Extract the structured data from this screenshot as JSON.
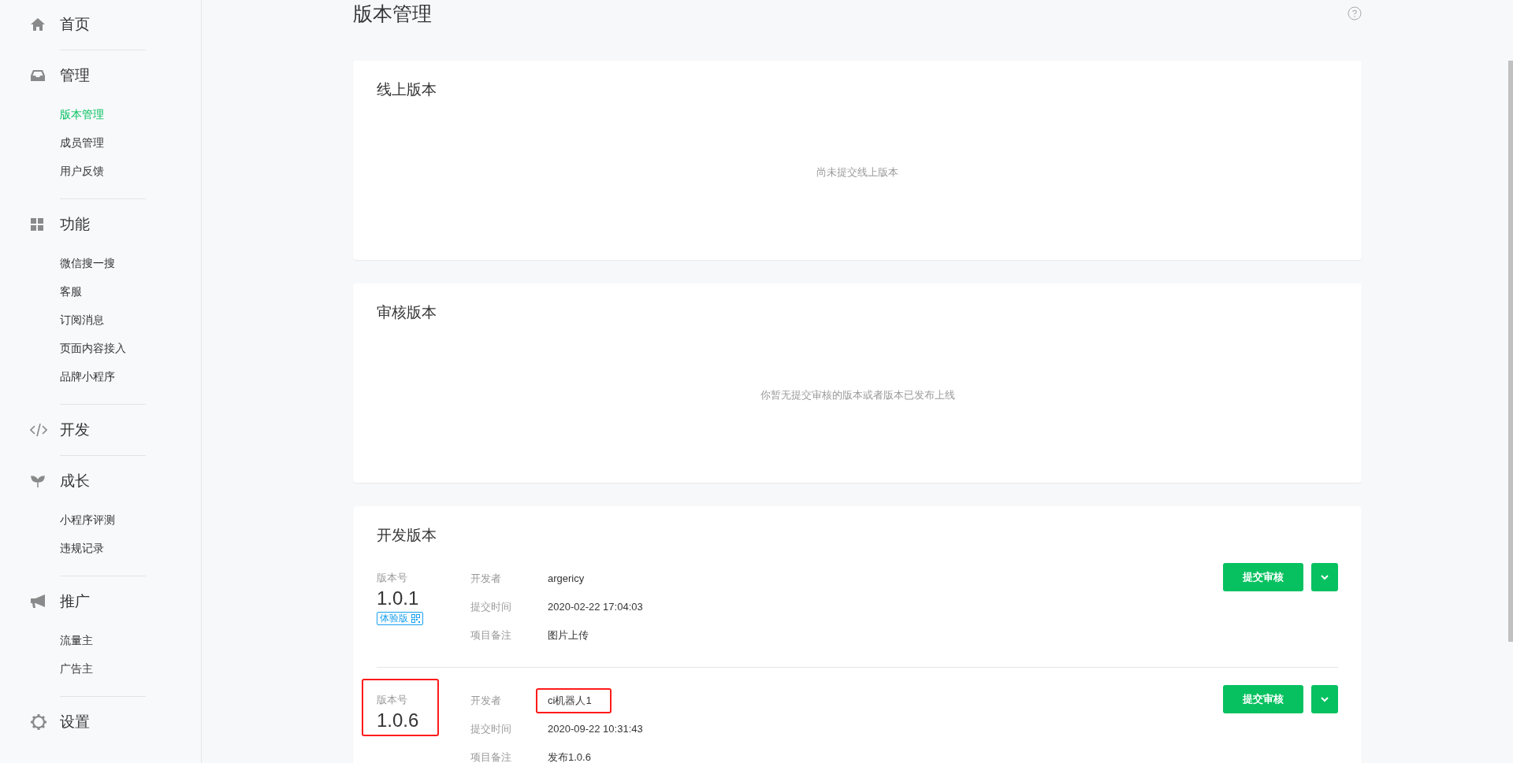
{
  "sidebar": {
    "groups": [
      {
        "label": "首页"
      },
      {
        "label": "管理",
        "items": [
          {
            "label": "版本管理",
            "selected": true
          },
          {
            "label": "成员管理",
            "selected": false
          },
          {
            "label": "用户反馈",
            "selected": false
          }
        ]
      },
      {
        "label": "功能",
        "items": [
          {
            "label": "微信搜一搜",
            "selected": false
          },
          {
            "label": "客服",
            "selected": false
          },
          {
            "label": "订阅消息",
            "selected": false
          },
          {
            "label": "页面内容接入",
            "selected": false
          },
          {
            "label": "品牌小程序",
            "selected": false
          }
        ]
      },
      {
        "label": "开发"
      },
      {
        "label": "成长",
        "items": [
          {
            "label": "小程序评测",
            "selected": false
          },
          {
            "label": "违规记录",
            "selected": false
          }
        ]
      },
      {
        "label": "推广",
        "items": [
          {
            "label": "流量主",
            "selected": false
          },
          {
            "label": "广告主",
            "selected": false
          }
        ]
      },
      {
        "label": "设置"
      }
    ]
  },
  "page": {
    "title": "版本管理"
  },
  "sections": [
    {
      "kind": "empty",
      "title": "线上版本",
      "message": "尚未提交线上版本"
    },
    {
      "kind": "empty",
      "title": "审核版本",
      "message": "你暂无提交审核的版本或者版本已发布上线"
    },
    {
      "kind": "list",
      "title": "开发版本",
      "versions": [
        {
          "label": "版本号",
          "number": "1.0.1",
          "badge": "体验版",
          "highlighted": false,
          "fields": [
            {
              "label": "开发者",
              "value": "argericy",
              "highlighted": false
            },
            {
              "label": "提交时间",
              "value": "2020-02-22 17:04:03",
              "highlighted": false
            },
            {
              "label": "项目备注",
              "value": "图片上传",
              "highlighted": false
            }
          ],
          "button": "提交审核"
        },
        {
          "label": "版本号",
          "number": "1.0.6",
          "highlighted": true,
          "fields": [
            {
              "label": "开发者",
              "value": "ci机器人1",
              "highlighted": true
            },
            {
              "label": "提交时间",
              "value": "2020-09-22 10:31:43",
              "highlighted": false
            },
            {
              "label": "项目备注",
              "value": "发布1.0.6",
              "highlighted": false
            }
          ],
          "button": "提交审核"
        }
      ]
    }
  ]
}
